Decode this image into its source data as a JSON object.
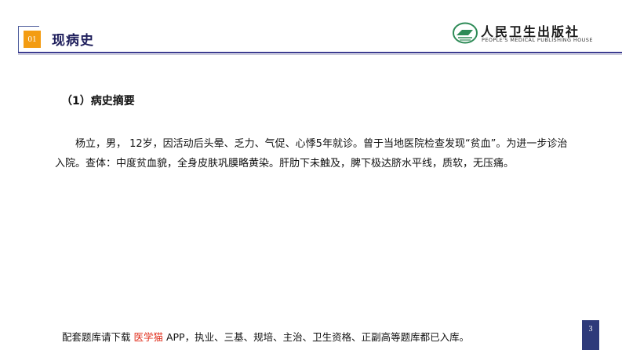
{
  "header": {
    "section_number": "01",
    "title": "现病史",
    "logo_cn": "人民卫生出版社",
    "logo_en": "PEOPLE'S MEDICAL PUBLISHING HOUSE"
  },
  "content": {
    "heading": "（1）病史摘要",
    "paragraph": "杨立，男， 12岁，因活动后头晕、乏力、气促、心悸5年就诊。曾于当地医院检查发现“贫血”。为进一步诊治入院。查体：中度贫血貌，全身皮肤巩膜略黄染。肝肋下未触及，脾下极达脐水平线，质软，无压痛。"
  },
  "footer": {
    "prefix": "配套题库请下载 ",
    "app_name": "医学猫",
    "suffix": " APP，执业、三基、规培、主治、卫生资格、正副高等题库都已入库。"
  },
  "page_number": "3",
  "colors": {
    "accent_orange": "#f39c12",
    "brand_navy": "#3b3b8f",
    "highlight_red": "#e0301e",
    "logo_green": "#2e8b57"
  }
}
